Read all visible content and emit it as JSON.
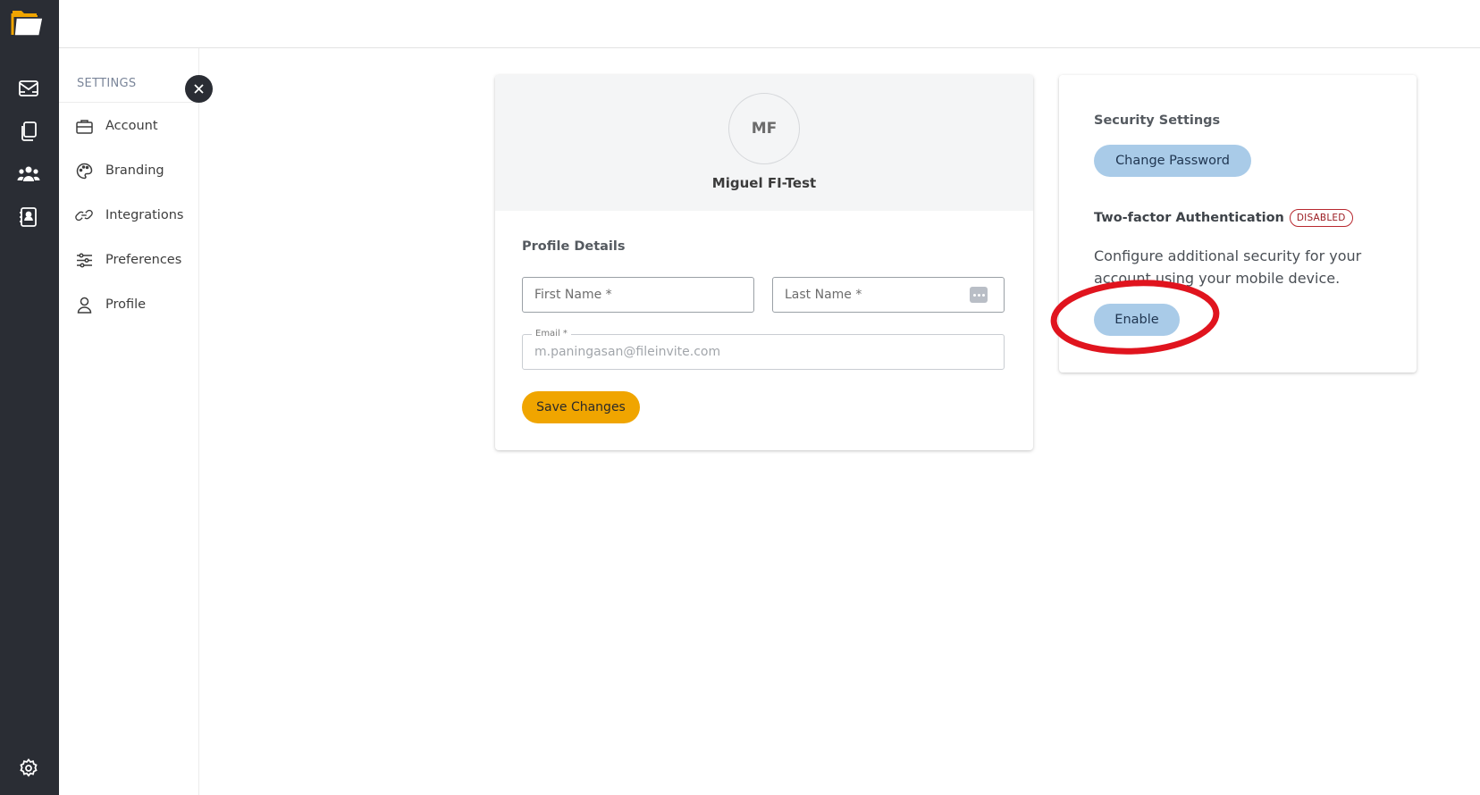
{
  "colors": {
    "rail_bg": "#2a2d34",
    "accent_yellow": "#f0a500",
    "soft_blue_button": "#a9cbe8",
    "disabled_badge": "#b8282f",
    "annotation_red": "#e0141e"
  },
  "rail": {
    "logo_icon": "folder-logo-icon",
    "items": [
      {
        "icon": "inbox-mail-icon"
      },
      {
        "icon": "documents-icon"
      },
      {
        "icon": "people-group-icon"
      },
      {
        "icon": "contacts-book-icon"
      }
    ],
    "bottom_icon": "gear-icon"
  },
  "settings_nav": {
    "title": "SETTINGS",
    "items": [
      {
        "label": "Account",
        "icon": "briefcase-icon"
      },
      {
        "label": "Branding",
        "icon": "palette-icon"
      },
      {
        "label": "Integrations",
        "icon": "link-icon"
      },
      {
        "label": "Preferences",
        "icon": "sliders-icon"
      },
      {
        "label": "Profile",
        "icon": "user-icon"
      }
    ],
    "close_icon": "close-icon"
  },
  "profile": {
    "initials": "MF",
    "name": "Miguel FI-Test",
    "section_title": "Profile Details",
    "first_name_placeholder": "First Name *",
    "last_name_placeholder": "Last Name *",
    "email_label": "Email *",
    "email_value": "m.paningasan@fileinvite.com",
    "save_label": "Save Changes"
  },
  "security": {
    "title": "Security Settings",
    "change_password_label": "Change Password",
    "tfa_label": "Two-factor Authentication",
    "tfa_status": "DISABLED",
    "tfa_description": "Configure additional security for your account using your mobile device.",
    "enable_label": "Enable"
  }
}
